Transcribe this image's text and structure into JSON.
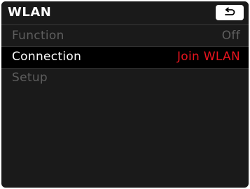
{
  "header": {
    "title": "WLAN"
  },
  "icons": {
    "back": "return-arrow-icon"
  },
  "menu": {
    "items": [
      {
        "label": "Function",
        "value": "Off",
        "state": "disabled"
      },
      {
        "label": "Connection",
        "value": "Join WLAN",
        "state": "selected"
      },
      {
        "label": "Setup",
        "value": "",
        "state": "disabled"
      }
    ]
  },
  "colors": {
    "background": "#1a1a1a",
    "selected_row": "#000000",
    "accent_value": "#e8141e",
    "disabled_text": "#5e5e5e",
    "text": "#ffffff"
  }
}
